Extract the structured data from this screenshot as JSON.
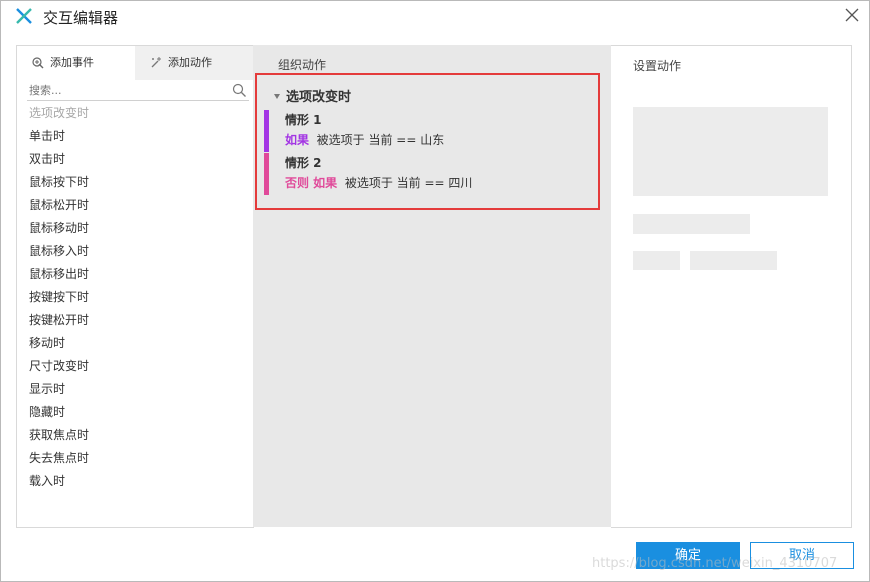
{
  "window": {
    "title": "交互编辑器",
    "logo_icon": "axure-x-icon",
    "close_icon": "close-icon"
  },
  "left_panel": {
    "tabs": [
      {
        "label": "添加事件",
        "icon": "add-event-icon",
        "active": true
      },
      {
        "label": "添加动作",
        "icon": "add-action-sparkle-icon",
        "active": false
      }
    ],
    "search": {
      "placeholder": "搜索...",
      "icon": "search-icon"
    },
    "events": [
      "选项改变时",
      "单击时",
      "双击时",
      "鼠标按下时",
      "鼠标松开时",
      "鼠标移动时",
      "鼠标移入时",
      "鼠标移出时",
      "按键按下时",
      "按键松开时",
      "移动时",
      "尺寸改变时",
      "显示时",
      "隐藏时",
      "获取焦点时",
      "失去焦点时",
      "载入时"
    ]
  },
  "middle_panel": {
    "header": "组织动作",
    "event_title": "选项改变时",
    "cases": [
      {
        "name": "情形 1",
        "keyword": "如果",
        "condition": "被选项于 当前 == 山东",
        "color": "#a335e4"
      },
      {
        "name": "情形 2",
        "keyword": "否则 如果",
        "condition": "被选项于 当前 == 四川",
        "color": "#e04a9a"
      }
    ]
  },
  "right_panel": {
    "header": "设置动作"
  },
  "footer": {
    "ok_label": "确定",
    "cancel_label": "取消",
    "watermark": "https://blog.csdn.net/weixin_4310707"
  },
  "colors": {
    "accent": "#1a8fe0",
    "highlight_border": "#e43b3b",
    "case1": "#a335e4",
    "case2": "#e04a9a"
  }
}
